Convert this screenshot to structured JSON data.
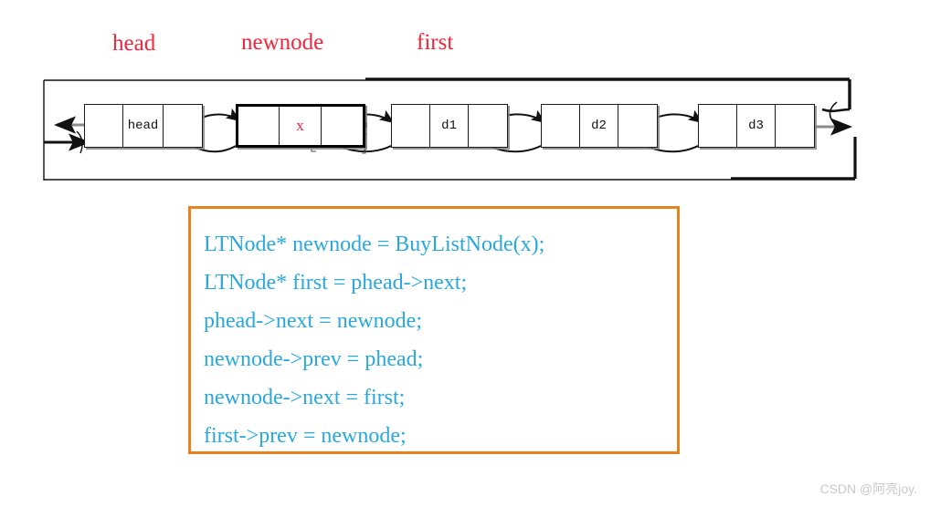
{
  "pointer_labels": [
    {
      "id": "head",
      "text": "head"
    },
    {
      "id": "newnode",
      "text": "newnode"
    },
    {
      "id": "first",
      "text": "first"
    }
  ],
  "list": {
    "nodes": [
      {
        "id": "head",
        "data": "head",
        "highlighted": false
      },
      {
        "id": "newnode",
        "data": "x",
        "highlighted": true
      },
      {
        "id": "d1",
        "data": "d1",
        "highlighted": false
      },
      {
        "id": "d2",
        "data": "d2",
        "highlighted": false
      },
      {
        "id": "d3",
        "data": "d3",
        "highlighted": false
      }
    ]
  },
  "code": {
    "lines": [
      "LTNode* newnode = BuyListNode(x);",
      "LTNode* first = phead->next;",
      "phead->next = newnode;",
      "newnode->prev = phead;",
      "newnode->next = first;",
      "first->prev = newnode;"
    ]
  },
  "colors": {
    "label_red": "#f4243a",
    "code_blue": "#29a8e0",
    "code_border_orange": "#e8821e",
    "node_border": "#1a1a1a",
    "link_gray": "#808080"
  },
  "watermark": {
    "text": "CSDN @阿亮joy."
  }
}
